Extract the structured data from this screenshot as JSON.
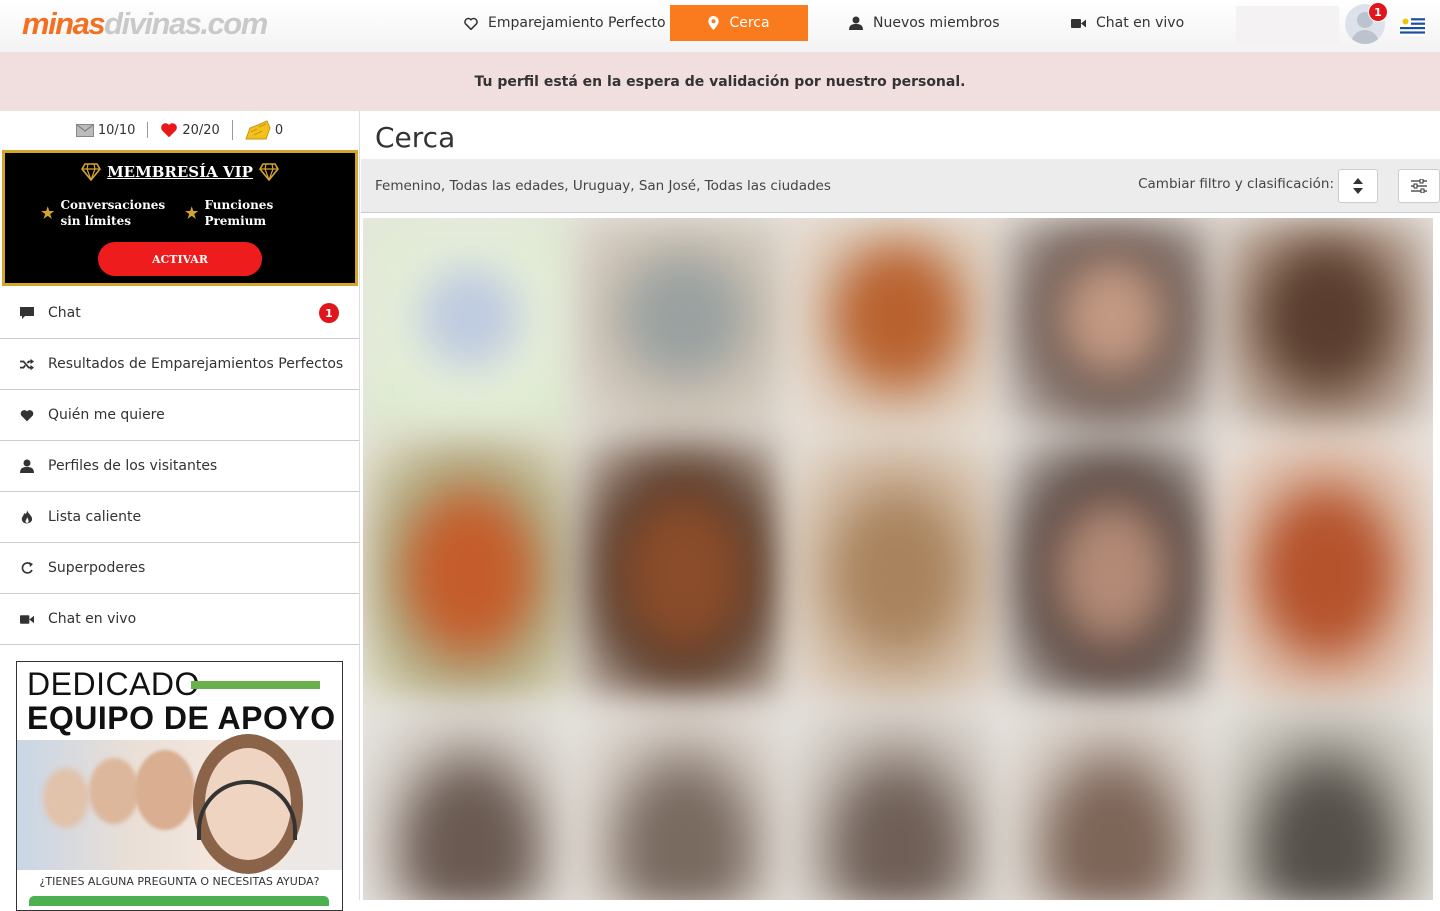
{
  "header": {
    "logo_part1": "minas",
    "logo_part2": "divinas.com",
    "nav": [
      {
        "label": "Emparejamiento Perfecto",
        "icon": "heart-outline-icon"
      },
      {
        "label": "Cerca",
        "icon": "map-pin-icon",
        "active": true
      },
      {
        "label": "Nuevos miembros",
        "icon": "user-icon"
      },
      {
        "label": "Chat en vivo",
        "icon": "video-camera-icon"
      }
    ],
    "notification_count": "1",
    "flag": "uruguay-flag-icon"
  },
  "banner": {
    "text": "Tu perfil está en la espera de validación por nuestro personal."
  },
  "sidebar": {
    "stats": [
      {
        "icon": "envelope-icon",
        "value": "10/10"
      },
      {
        "icon": "heart-icon",
        "value": "20/20"
      },
      {
        "icon": "coins-icon",
        "value": "0"
      }
    ],
    "vip": {
      "title": "MEMBRESÍA VIP",
      "feature1": "Conversaciones sin límites",
      "feature2": "Funciones Premium",
      "button": "ACTIVAR"
    },
    "menu": [
      {
        "label": "Chat",
        "icon": "chat-bubble-icon",
        "badge": "1"
      },
      {
        "label": "Resultados de Emparejamientos Perfectos",
        "icon": "shuffle-icon"
      },
      {
        "label": "Quién me quiere",
        "icon": "heart-icon"
      },
      {
        "label": "Perfiles de los visitantes",
        "icon": "user-icon"
      },
      {
        "label": "Lista caliente",
        "icon": "flame-icon"
      },
      {
        "label": "Superpoderes",
        "icon": "refresh-icon"
      },
      {
        "label": "Chat en vivo",
        "icon": "video-camera-icon"
      }
    ],
    "support": {
      "line1": "DEDICADO",
      "line2": "EQUIPO DE APOYO",
      "question": "¿TIENES ALGUNA PREGUNTA O NECESITAS AYUDA?"
    }
  },
  "main": {
    "title": "Cerca",
    "filter_summary": "Femenino, Todas las edades, Uruguay, San José, Todas las ciudades",
    "filter_label": "Cambiar filtro y clasificación:"
  },
  "colors": {
    "accent": "#fa7a1e",
    "banner_bg": "#f1dedf",
    "badge": "#e0161d",
    "vip_border": "#d4a52a",
    "vip_button": "#ee1c1c"
  }
}
